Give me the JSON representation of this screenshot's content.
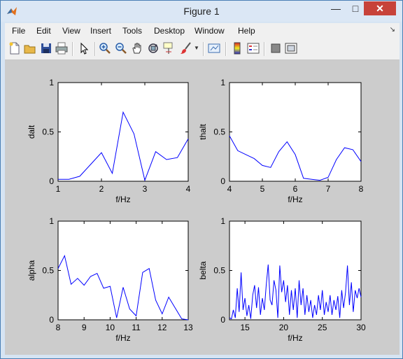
{
  "window": {
    "title": "Figure 1"
  },
  "menu": [
    "File",
    "Edit",
    "View",
    "Insert",
    "Tools",
    "Desktop",
    "Window",
    "Help"
  ],
  "toolbar": [
    "new-figure",
    "open-file",
    "save",
    "print",
    "select-arrow",
    "zoom-in",
    "zoom-out",
    "pan",
    "rotate-3d",
    "data-cursor",
    "brush",
    "link-plot",
    "colorbar",
    "legend",
    "hide-plot-tools",
    "show-plot-tools"
  ],
  "chart_data": [
    {
      "type": "line",
      "xlabel": "f/Hz",
      "ylabel": "dalt",
      "xlim": [
        1,
        4
      ],
      "ylim": [
        0,
        1
      ],
      "xticks": [
        1,
        2,
        3,
        4
      ],
      "yticks": [
        0,
        0.5,
        1
      ],
      "x": [
        1.0,
        1.25,
        1.5,
        1.75,
        2.0,
        2.25,
        2.5,
        2.75,
        3.0,
        3.25,
        3.5,
        3.75,
        4.0
      ],
      "y": [
        0.02,
        0.02,
        0.05,
        0.17,
        0.29,
        0.08,
        0.7,
        0.48,
        0.01,
        0.3,
        0.22,
        0.24,
        0.43
      ]
    },
    {
      "type": "line",
      "xlabel": "f/Hz",
      "ylabel": "thalt",
      "xlim": [
        4,
        8
      ],
      "ylim": [
        0,
        1
      ],
      "xticks": [
        4,
        5,
        6,
        7,
        8
      ],
      "yticks": [
        0,
        0.5,
        1
      ],
      "x": [
        4.0,
        4.25,
        4.5,
        4.75,
        5.0,
        5.25,
        5.5,
        5.75,
        6.0,
        6.25,
        6.5,
        6.75,
        7.0,
        7.25,
        7.5,
        7.75,
        8.0
      ],
      "y": [
        0.46,
        0.31,
        0.27,
        0.23,
        0.16,
        0.14,
        0.3,
        0.4,
        0.27,
        0.03,
        0.02,
        0.01,
        0.04,
        0.22,
        0.34,
        0.32,
        0.2
      ]
    },
    {
      "type": "line",
      "xlabel": "f/Hz",
      "ylabel": "alpha",
      "xlim": [
        8,
        13
      ],
      "ylim": [
        0,
        1
      ],
      "xticks": [
        8,
        9,
        10,
        11,
        12,
        13
      ],
      "yticks": [
        0,
        0.5,
        1
      ],
      "x": [
        8.0,
        8.25,
        8.5,
        8.75,
        9.0,
        9.25,
        9.5,
        9.75,
        10.0,
        10.25,
        10.5,
        10.75,
        11.0,
        11.25,
        11.5,
        11.75,
        12.0,
        12.25,
        12.5,
        12.75,
        13.0
      ],
      "y": [
        0.52,
        0.65,
        0.36,
        0.42,
        0.35,
        0.44,
        0.47,
        0.32,
        0.34,
        0.02,
        0.33,
        0.11,
        0.04,
        0.48,
        0.52,
        0.2,
        0.06,
        0.23,
        0.12,
        0.01,
        0.0
      ]
    },
    {
      "type": "line",
      "xlabel": "f/Hz",
      "ylabel": "belta",
      "xlim": [
        13,
        30
      ],
      "ylim": [
        0,
        1
      ],
      "xticks": [
        15,
        20,
        25,
        30
      ],
      "yticks": [
        0,
        0.5,
        1
      ],
      "x": [
        13.0,
        13.25,
        13.5,
        13.75,
        14.0,
        14.25,
        14.5,
        14.75,
        15.0,
        15.25,
        15.5,
        15.75,
        16.0,
        16.25,
        16.5,
        16.75,
        17.0,
        17.25,
        17.5,
        17.75,
        18.0,
        18.25,
        18.5,
        18.75,
        19.0,
        19.25,
        19.5,
        19.75,
        20.0,
        20.25,
        20.5,
        20.75,
        21.0,
        21.25,
        21.5,
        21.75,
        22.0,
        22.25,
        22.5,
        22.75,
        23.0,
        23.25,
        23.5,
        23.75,
        24.0,
        24.25,
        24.5,
        24.75,
        25.0,
        25.25,
        25.5,
        25.75,
        26.0,
        26.25,
        26.5,
        26.75,
        27.0,
        27.25,
        27.5,
        27.75,
        28.0,
        28.25,
        28.5,
        28.75,
        29.0,
        29.25,
        29.5,
        29.75,
        30.0
      ],
      "y": [
        0.02,
        0.01,
        0.1,
        0.02,
        0.32,
        0.08,
        0.48,
        0.1,
        0.22,
        0.04,
        0.15,
        0.01,
        0.25,
        0.35,
        0.12,
        0.33,
        0.05,
        0.22,
        0.1,
        0.35,
        0.56,
        0.2,
        0.15,
        0.4,
        0.3,
        0.02,
        0.55,
        0.28,
        0.4,
        0.18,
        0.35,
        0.05,
        0.3,
        0.1,
        0.32,
        0.02,
        0.4,
        0.15,
        0.32,
        0.05,
        0.25,
        0.08,
        0.2,
        0.02,
        0.15,
        0.05,
        0.25,
        0.1,
        0.3,
        0.05,
        0.18,
        0.08,
        0.25,
        0.05,
        0.2,
        0.1,
        0.24,
        0.02,
        0.3,
        0.12,
        0.28,
        0.55,
        0.15,
        0.38,
        0.08,
        0.3,
        0.22,
        0.32,
        0.23
      ]
    }
  ]
}
